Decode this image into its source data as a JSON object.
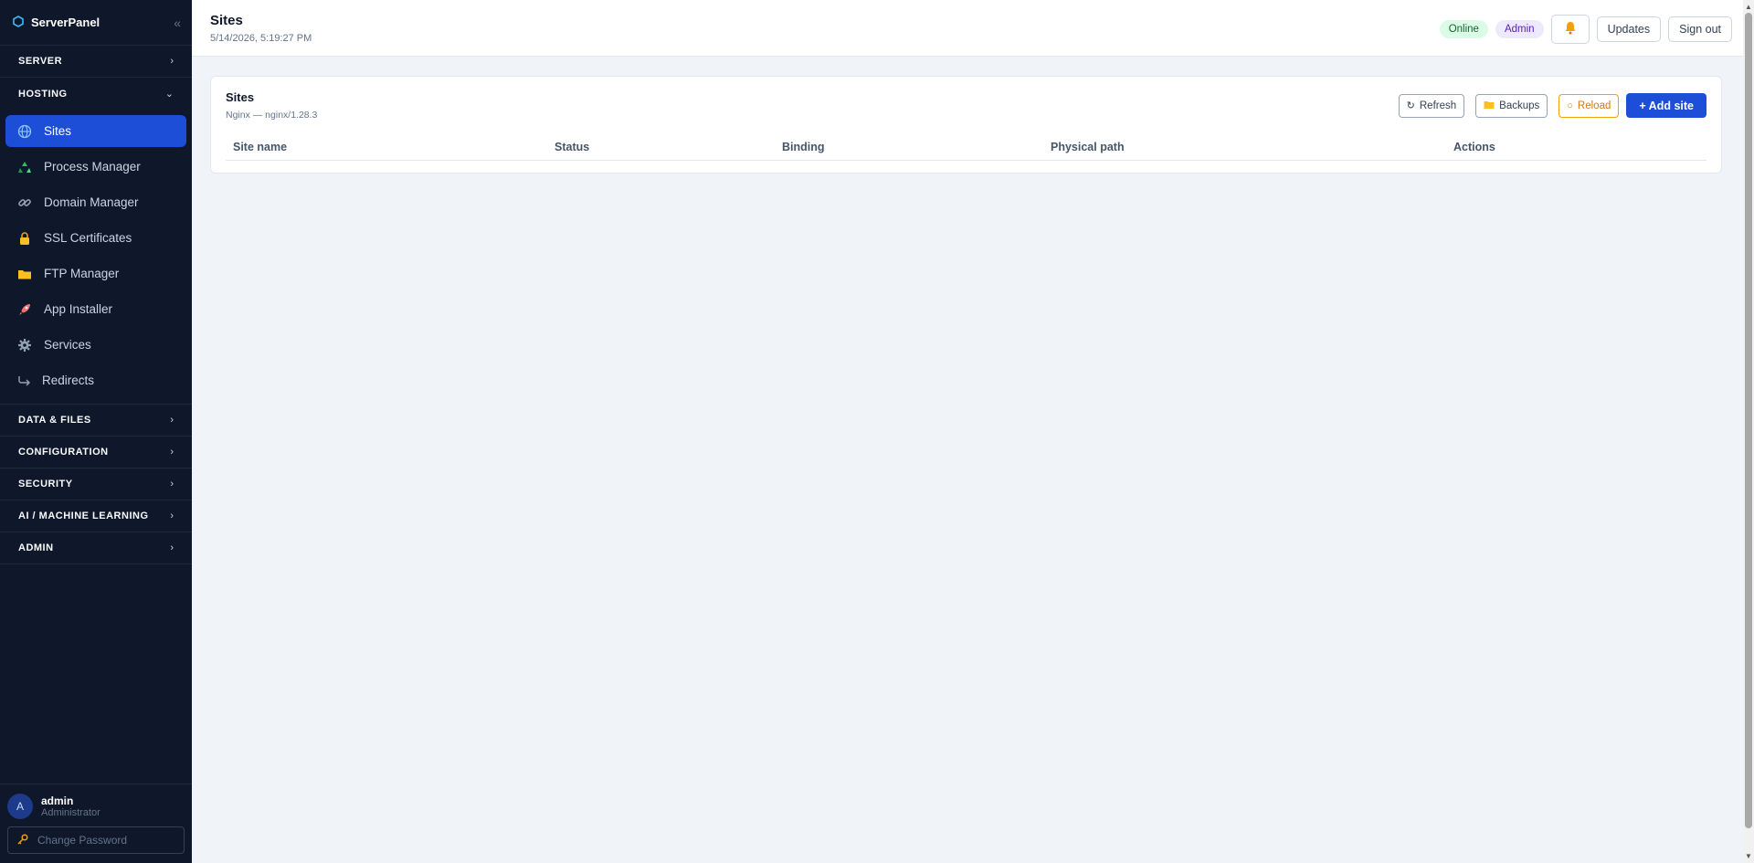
{
  "app": {
    "name": "ServerPanel",
    "collapse_icon": "«"
  },
  "sidebar": {
    "sections_top": [
      {
        "label": "SERVER",
        "expanded": false
      }
    ],
    "hosting": {
      "label": "HOSTING",
      "expanded": true,
      "items": [
        {
          "label": "Sites",
          "icon": "globe-icon",
          "active": true
        },
        {
          "label": "Process Manager",
          "icon": "recycle-icon",
          "active": false
        },
        {
          "label": "Domain Manager",
          "icon": "link-icon",
          "active": false
        },
        {
          "label": "SSL Certificates",
          "icon": "lock-icon",
          "active": false
        },
        {
          "label": "FTP Manager",
          "icon": "folder-icon",
          "active": false
        },
        {
          "label": "App Installer",
          "icon": "rocket-icon",
          "active": false
        },
        {
          "label": "Services",
          "icon": "gear-icon",
          "active": false
        },
        {
          "label": "Redirects",
          "icon": "redirect-arrow-icon",
          "active": false
        }
      ]
    },
    "sections_bottom": [
      {
        "label": "DATA & FILES",
        "expanded": false
      },
      {
        "label": "CONFIGURATION",
        "expanded": false
      },
      {
        "label": "SECURITY",
        "expanded": false
      },
      {
        "label": "AI / MACHINE LEARNING",
        "expanded": false
      },
      {
        "label": "ADMIN",
        "expanded": false
      }
    ],
    "user": {
      "initial": "A",
      "name": "admin",
      "role": "Administrator",
      "change_password": "Change Password"
    }
  },
  "header": {
    "title": "Sites",
    "timestamp": "5/14/2026, 5:19:27 PM",
    "status_online": "Online",
    "role_badge": "Admin",
    "updates_label": "Updates",
    "signout_label": "Sign out"
  },
  "card": {
    "title": "Sites",
    "subtitle": "Nginx — nginx/1.28.3",
    "actions": {
      "refresh": "Refresh",
      "backups": "Backups",
      "reload": "Reload",
      "add_site": "+ Add site"
    },
    "table": {
      "columns": [
        "Site name",
        "Status",
        "Binding",
        "Physical path",
        "Actions"
      ],
      "rows": []
    }
  },
  "colors": {
    "sidebar_bg": "#0f172a",
    "accent": "#1d4ed8",
    "online_bg": "#dcfce7",
    "admin_bg": "#ede9fe",
    "reload": "#f59e0b"
  }
}
